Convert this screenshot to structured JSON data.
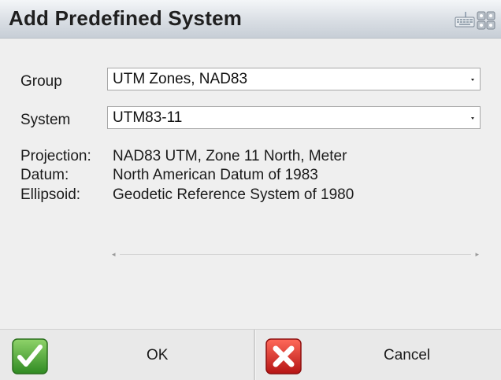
{
  "window": {
    "title": "Add Predefined System",
    "titlebar_icons": [
      "keyboard-icon",
      "grid-menu-icon"
    ]
  },
  "form": {
    "group_label": "Group",
    "group_value": "UTM Zones, NAD83",
    "system_label": "System",
    "system_value": "UTM83-11"
  },
  "details": {
    "projection_label": "Projection:",
    "projection_value": "NAD83 UTM, Zone 11 North, Meter",
    "datum_label": "Datum:",
    "datum_value": "North American Datum of 1983",
    "ellipsoid_label": "Ellipsoid:",
    "ellipsoid_value": "Geodetic Reference System of 1980"
  },
  "buttons": {
    "ok_label": "OK",
    "cancel_label": "Cancel"
  },
  "colors": {
    "ok_icon": "#3a9a2a",
    "cancel_icon": "#cc2222",
    "background": "#efefef"
  }
}
